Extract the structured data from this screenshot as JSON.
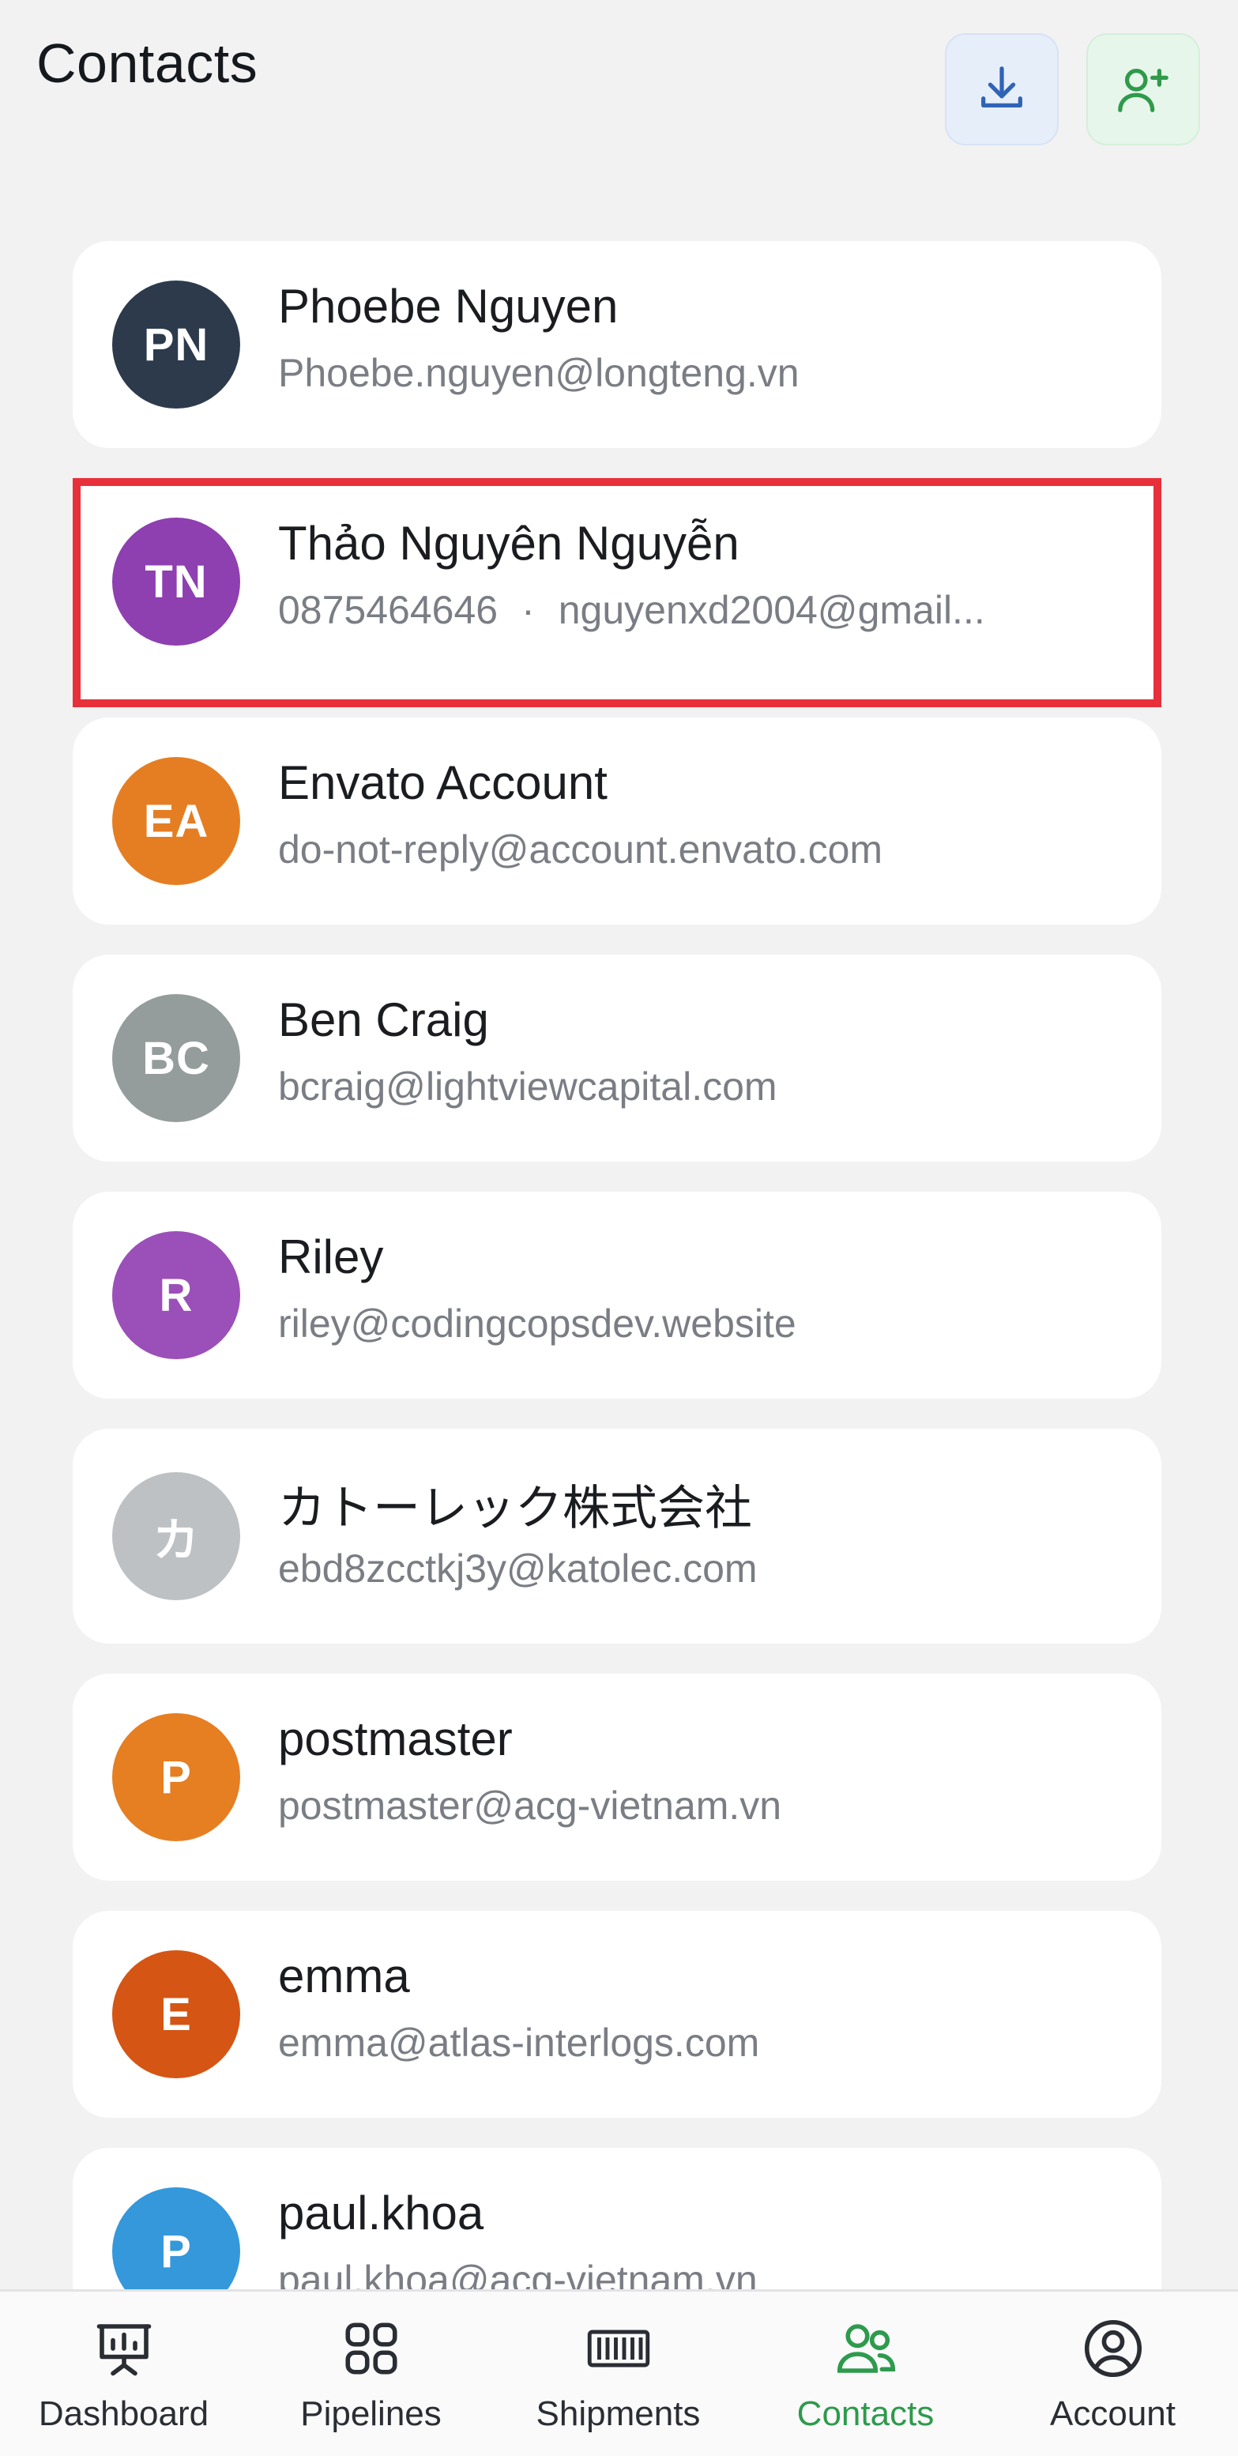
{
  "header": {
    "title": "Contacts"
  },
  "contacts": [
    {
      "initials": "PN",
      "name": "Phoebe Nguyen",
      "phone": "",
      "email": "Phoebe.nguyen@longteng.vn",
      "color": "#2c3a4c"
    },
    {
      "initials": "TN",
      "name": "Thảo Nguyên Nguyễn",
      "phone": "0875464646",
      "separator": "·",
      "email": "nguyenxd2004@gmail...",
      "color": "#8e3fb0"
    },
    {
      "initials": "EA",
      "name": "Envato Account",
      "phone": "",
      "email": "do-not-reply@account.envato.com",
      "color": "#e57e22"
    },
    {
      "initials": "BC",
      "name": "Ben Craig",
      "phone": "",
      "email": "bcraig@lightviewcapital.com",
      "color": "#949d9c"
    },
    {
      "initials": "R",
      "name": "Riley",
      "phone": "",
      "email": "riley@codingcopsdev.website",
      "color": "#9b4fb8"
    },
    {
      "initials": "カ",
      "name": "カトーレック株式会社",
      "phone": "",
      "email": "ebd8zcctkj3y@katolec.com",
      "color": "#bdc1c4"
    },
    {
      "initials": "P",
      "name": "postmaster",
      "phone": "",
      "email": "postmaster@acg-vietnam.vn",
      "color": "#e67e22"
    },
    {
      "initials": "E",
      "name": "emma",
      "phone": "",
      "email": "emma@atlas-interlogs.com",
      "color": "#d55514"
    },
    {
      "initials": "P",
      "name": "paul.khoa",
      "phone": "",
      "email": "paul.khoa@acg-vietnam.vn",
      "color": "#3498db"
    }
  ],
  "highlighted_contact_index": 1,
  "tabs": [
    {
      "label": "Dashboard",
      "icon": "presentation-chart-icon"
    },
    {
      "label": "Pipelines",
      "icon": "grid-icon"
    },
    {
      "label": "Shipments",
      "icon": "container-icon"
    },
    {
      "label": "Contacts",
      "icon": "users-icon",
      "active": true
    },
    {
      "label": "Account",
      "icon": "user-circle-icon"
    }
  ],
  "colors": {
    "active_tab": "#2e9a4d",
    "highlight_border": "#e8303a",
    "download_button_bg": "#e6eefa",
    "add_button_bg": "#e6f6ea"
  }
}
